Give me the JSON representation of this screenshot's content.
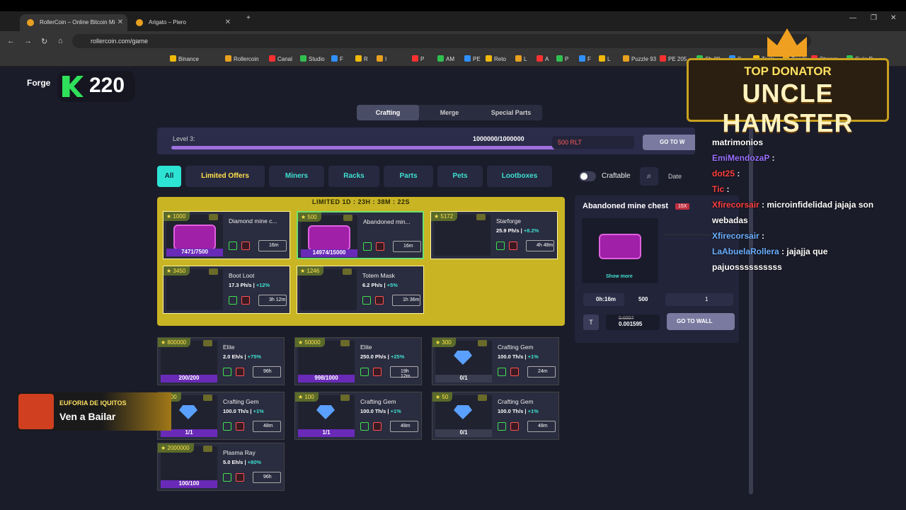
{
  "browser": {
    "tabs": [
      {
        "title": "RollerCoin – Online Bitcoin Mi"
      },
      {
        "title": "Arigato – Piero"
      }
    ],
    "url": "rollercoin.com/game",
    "bookmarks": [
      "Binance",
      "Rollercoin",
      "Canal",
      "Studio",
      "F",
      "R",
      "I",
      "P",
      "AM",
      "PE",
      "Reto",
      "L",
      "A",
      "P",
      "F",
      "L",
      "Puzzle 93",
      "PE 205",
      "Ch 08",
      "S",
      "Tools",
      "Seeds",
      "Stream",
      "Guía P"
    ]
  },
  "header": {
    "forge": "Forge",
    "score": "220"
  },
  "segments": [
    "Crafting",
    "Merge",
    "Special Parts"
  ],
  "level": {
    "label": "Level 3:",
    "progress": "1000000/1000000",
    "rlt": "500 RLT",
    "go": "GO TO W"
  },
  "filters": [
    "All",
    "Limited Offers",
    "Miners",
    "Racks",
    "Parts",
    "Pets",
    "Lootboxes"
  ],
  "craftable": "Craftable",
  "date": "Date",
  "limited": {
    "title": "LIMITED 1D : 23H : 38M : 22S",
    "cards": [
      {
        "price": "1000",
        "name": "Diamond mine c...",
        "count": "7471/7500",
        "time": "16m"
      },
      {
        "price": "500",
        "name": "Abandoned min...",
        "count": "14974/15000",
        "time": "16m"
      },
      {
        "price": "5172",
        "name": "Starforge",
        "power": "25.9 Ph/s",
        "bonus": "+8.2%",
        "time": "4h 48m"
      },
      {
        "price": "3450",
        "name": "Boot Loot",
        "power": "17.3 Ph/s",
        "bonus": "+12%",
        "time": "3h 12m"
      },
      {
        "price": "1246",
        "name": "Totem Mask",
        "power": "6.2 Ph/s",
        "bonus": "+5%",
        "time": "1h 36m"
      }
    ]
  },
  "cards": [
    {
      "price": "800000",
      "name": "Elite",
      "power": "2.0 Eh/s",
      "bonus": "+75%",
      "time": "96h",
      "count": "200/200"
    },
    {
      "price": "50000",
      "name": "Elite",
      "power": "250.0 Ph/s",
      "bonus": "+25%",
      "time": "19h 12m",
      "count": "998/1000"
    },
    {
      "price": "300",
      "name": "Crafting Gem",
      "power": "100.0 Th/s",
      "bonus": "+1%",
      "time": "24m",
      "count": "0/1"
    },
    {
      "price": "100",
      "name": "Crafting Gem",
      "power": "100.0 Th/s",
      "bonus": "+1%",
      "time": "48m",
      "count": "1/1"
    },
    {
      "price": "100",
      "name": "Crafting Gem",
      "power": "100.0 Th/s",
      "bonus": "+1%",
      "time": "48m",
      "count": "1/1"
    },
    {
      "price": "50",
      "name": "Crafting Gem",
      "power": "100.0 Th/s",
      "bonus": "+1%",
      "time": "48m",
      "count": "0/1"
    },
    {
      "price": "2000000",
      "name": "Plasma Ray",
      "power": "5.0 Eh/s",
      "bonus": "+80%",
      "time": "96h",
      "count": "100/100"
    }
  ],
  "side": {
    "title": "Abandoned mine chest",
    "badge": "15X",
    "show_more": "Show more",
    "time": "0h:16m",
    "price": "500",
    "qty": "1",
    "cost_old": "0.0007",
    "cost": "0.001595",
    "go": "GO TO WALL"
  },
  "overlay": {
    "top": "TOP DONATOR",
    "name": "UNCLE HAMSTER",
    "promo_title": "EUFORIA DE IQUITOS",
    "promo_sub": "Ven a Bailar"
  },
  "chat": [
    {
      "text": "matrimonios"
    },
    {
      "user": "EmiMendozaP",
      "text": ""
    },
    {
      "user": "dot25",
      "text": ""
    },
    {
      "user": "Tic",
      "text": ""
    },
    {
      "user": "Xfirecorsair",
      "text": "microinfidelidad jajaja son webadas"
    },
    {
      "user": "Xfirecorsair",
      "text": ""
    },
    {
      "user": "LaAbuelaRollera",
      "text": "jajajja que pajuossssssssss"
    }
  ]
}
